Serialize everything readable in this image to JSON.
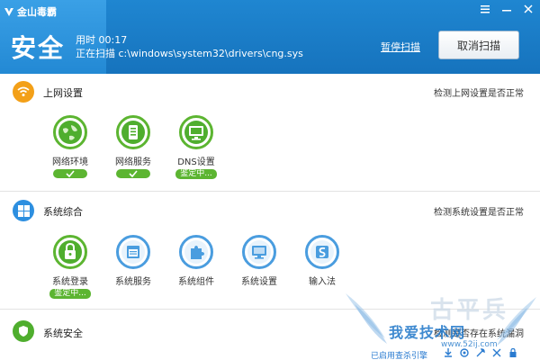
{
  "app": {
    "logo_text": "金山毒霸"
  },
  "header": {
    "status": "安全",
    "time_label": "用时",
    "time_value": "00:17",
    "scan_label": "正在扫描",
    "scan_path": "c:\\windows\\system32\\drivers\\cng.sys",
    "pause_label": "暂停扫描",
    "cancel_label": "取消扫描",
    "window_controls": [
      "menu-icon",
      "minimize-icon",
      "close-icon"
    ]
  },
  "sections": [
    {
      "title": "上网设置",
      "right_text": "检测上网设置是否正常",
      "icon": "wifi-icon",
      "icon_color": "#f3a018",
      "items": [
        {
          "label": "网络环境",
          "icon": "globe-icon",
          "status": "check"
        },
        {
          "label": "网络服务",
          "icon": "server-icon",
          "status": "check"
        },
        {
          "label": "DNS设置",
          "icon": "monitor-icon",
          "status": "鉴定中..."
        }
      ]
    },
    {
      "title": "系统综合",
      "right_text": "检测系统设置是否正常",
      "icon": "windows-icon",
      "icon_color": "#2d8fe0",
      "items": [
        {
          "label": "系统登录",
          "icon": "lock-icon",
          "status": "鉴定中..."
        },
        {
          "label": "系统服务",
          "icon": "window-icon",
          "status": ""
        },
        {
          "label": "系统组件",
          "icon": "puzzle-icon",
          "status": ""
        },
        {
          "label": "系统设置",
          "icon": "display-icon",
          "status": ""
        },
        {
          "label": "输入法",
          "icon": "input-method-icon",
          "status": ""
        }
      ]
    },
    {
      "title": "系统安全",
      "right_text": "检测是否存在系统漏洞",
      "icon": "shield-icon",
      "icon_color": "#4fae2e",
      "items": []
    }
  ],
  "footer": {
    "link_text": "已启用查杀引擎"
  },
  "watermark": {
    "text": "我爱技术网",
    "url": "www.52ij.com",
    "big": "古平兵"
  },
  "colors": {
    "header_blue": "#1a7cc7",
    "ok_green": "#5cb531",
    "accent_blue": "#4a9ddf"
  }
}
